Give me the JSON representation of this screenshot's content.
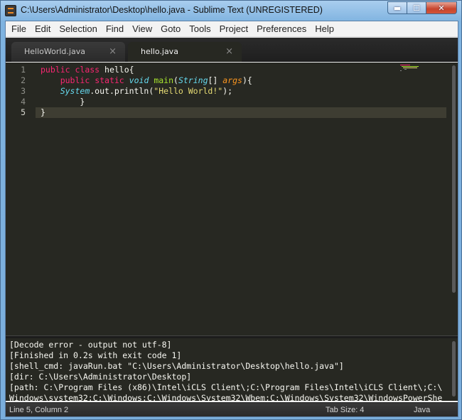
{
  "window": {
    "title": "C:\\Users\\Administrator\\Desktop\\hello.java - Sublime Text (UNREGISTERED)",
    "minimize": "▬",
    "maximize": "☐",
    "close": "✕"
  },
  "menu": [
    "File",
    "Edit",
    "Selection",
    "Find",
    "View",
    "Goto",
    "Tools",
    "Project",
    "Preferences",
    "Help"
  ],
  "tabs": [
    {
      "label": "HelloWorld.java",
      "close": "×",
      "active": false
    },
    {
      "label": "hello.java",
      "close": "×",
      "active": true
    }
  ],
  "editor": {
    "line_numbers": [
      "1",
      "2",
      "3",
      "4",
      "5"
    ],
    "current_line": 5,
    "code": [
      [
        {
          "t": "public",
          "c": "kw"
        },
        {
          "t": " ",
          "c": "wt"
        },
        {
          "t": "class",
          "c": "kw"
        },
        {
          "t": " hello{",
          "c": "wt"
        }
      ],
      [
        {
          "t": "    ",
          "c": "wt"
        },
        {
          "t": "public",
          "c": "kw"
        },
        {
          "t": " ",
          "c": "wt"
        },
        {
          "t": "static",
          "c": "kw"
        },
        {
          "t": " ",
          "c": "wt"
        },
        {
          "t": "void",
          "c": "st"
        },
        {
          "t": " ",
          "c": "wt"
        },
        {
          "t": "main",
          "c": "fn"
        },
        {
          "t": "(",
          "c": "wt"
        },
        {
          "t": "String",
          "c": "st"
        },
        {
          "t": "[] ",
          "c": "wt"
        },
        {
          "t": "args",
          "c": "ar"
        },
        {
          "t": "){",
          "c": "wt"
        }
      ],
      [
        {
          "t": "    ",
          "c": "wt"
        },
        {
          "t": "System",
          "c": "st"
        },
        {
          "t": ".out.println(",
          "c": "wt"
        },
        {
          "t": "\"Hello World!\"",
          "c": "sg"
        },
        {
          "t": ");",
          "c": "wt"
        }
      ],
      [
        {
          "t": "        }",
          "c": "wt"
        }
      ],
      [
        {
          "t": "}",
          "c": "wt"
        }
      ]
    ]
  },
  "output": [
    "[Decode error - output not utf-8]",
    "[Finished in 0.2s with exit code 1]",
    "[shell_cmd: javaRun.bat \"C:\\Users\\Administrator\\Desktop\\hello.java\"]",
    "[dir: C:\\Users\\Administrator\\Desktop]",
    "[path: C:\\Program Files (x86)\\Intel\\iCLS Client\\;C:\\Program Files\\Intel\\iCLS Client\\;C:\\",
    "Windows\\system32;C:\\Windows;C:\\Windows\\System32\\Wbem;C:\\Windows\\System32\\WindowsPowerShe"
  ],
  "status": {
    "position": "Line 5, Column 2",
    "tab_size": "Tab Size: 4",
    "syntax": "Java"
  },
  "colors": {
    "editor_bg": "#272822",
    "keyword": "#f92672",
    "type": "#66d9ef",
    "function": "#a6e22e",
    "argument": "#fd971f",
    "string": "#e6db74"
  }
}
